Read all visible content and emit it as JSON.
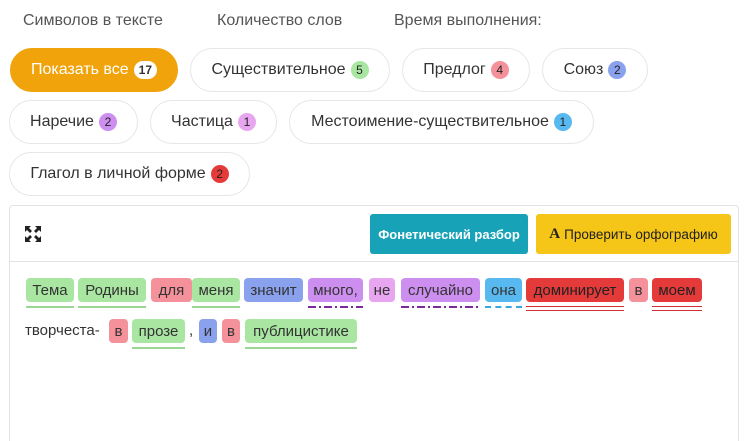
{
  "stats": {
    "chars_label": "Символов в тексте",
    "words_label": "Количество слов",
    "time_label": "Время выполнения:"
  },
  "filters": [
    {
      "label": "Показать все",
      "count": "17",
      "active": true,
      "badge_color": "#ffffff"
    },
    {
      "label": "Существительное",
      "count": "5",
      "active": false,
      "badge_color": "#a8e6a1"
    },
    {
      "label": "Предлог",
      "count": "4",
      "active": false,
      "badge_color": "#f4919a"
    },
    {
      "label": "Союз",
      "count": "2",
      "active": false,
      "badge_color": "#8aa2ee"
    },
    {
      "label": "Наречие",
      "count": "2",
      "active": false,
      "badge_color": "#cc8ff0"
    },
    {
      "label": "Частица",
      "count": "1",
      "active": false,
      "badge_color": "#e7a6ef"
    },
    {
      "label": "Местоимение-существительное",
      "count": "1",
      "active": false,
      "badge_color": "#58b9f0"
    },
    {
      "label": "Глагол в личной форме",
      "count": "2",
      "active": false,
      "badge_color": "#e53a3a"
    }
  ],
  "toolbar": {
    "expand_icon": "expand-arrows-icon",
    "phonetic_label": "Фонетический разбор",
    "spell_icon": "A",
    "spell_label": "Проверить орфографию"
  },
  "colors": {
    "noun": "#a8e6a1",
    "preposition": "#f4919a",
    "conjunction": "#8aa2ee",
    "adverb": "#cc8ff0",
    "particle": "#e7a6ef",
    "pronoun": "#58b9f0",
    "verb": "#e53a3a",
    "accent": "#f0a30a",
    "phonetic_button": "#17a2b8",
    "spell_button": "#f5c518"
  },
  "text": {
    "tokens": [
      {
        "text": "Тема",
        "pos": "noun"
      },
      {
        "text": "Родины",
        "pos": "noun"
      },
      {
        "text": "для",
        "pos": "preposition"
      },
      {
        "text": "меня",
        "pos": "noun"
      },
      {
        "text": "значит",
        "pos": "conjunction"
      },
      {
        "text": "много,",
        "pos": "adverb"
      },
      {
        "text": "не",
        "pos": "particle"
      },
      {
        "text": "случайно",
        "pos": "adverb"
      },
      {
        "text": "она",
        "pos": "pronoun"
      },
      {
        "text": "доминирует",
        "pos": "verb"
      },
      {
        "text": "в",
        "pos": "preposition"
      },
      {
        "text": "моем",
        "pos": "verb"
      },
      {
        "text": "творчеста-",
        "pos": "none"
      },
      {
        "text": "в",
        "pos": "preposition"
      },
      {
        "text": "прозе",
        "pos": "noun"
      },
      {
        "text": ",",
        "pos": "none"
      },
      {
        "text": "и",
        "pos": "conjunction"
      },
      {
        "text": "в",
        "pos": "preposition"
      },
      {
        "text": "публицистике",
        "pos": "noun"
      }
    ]
  }
}
